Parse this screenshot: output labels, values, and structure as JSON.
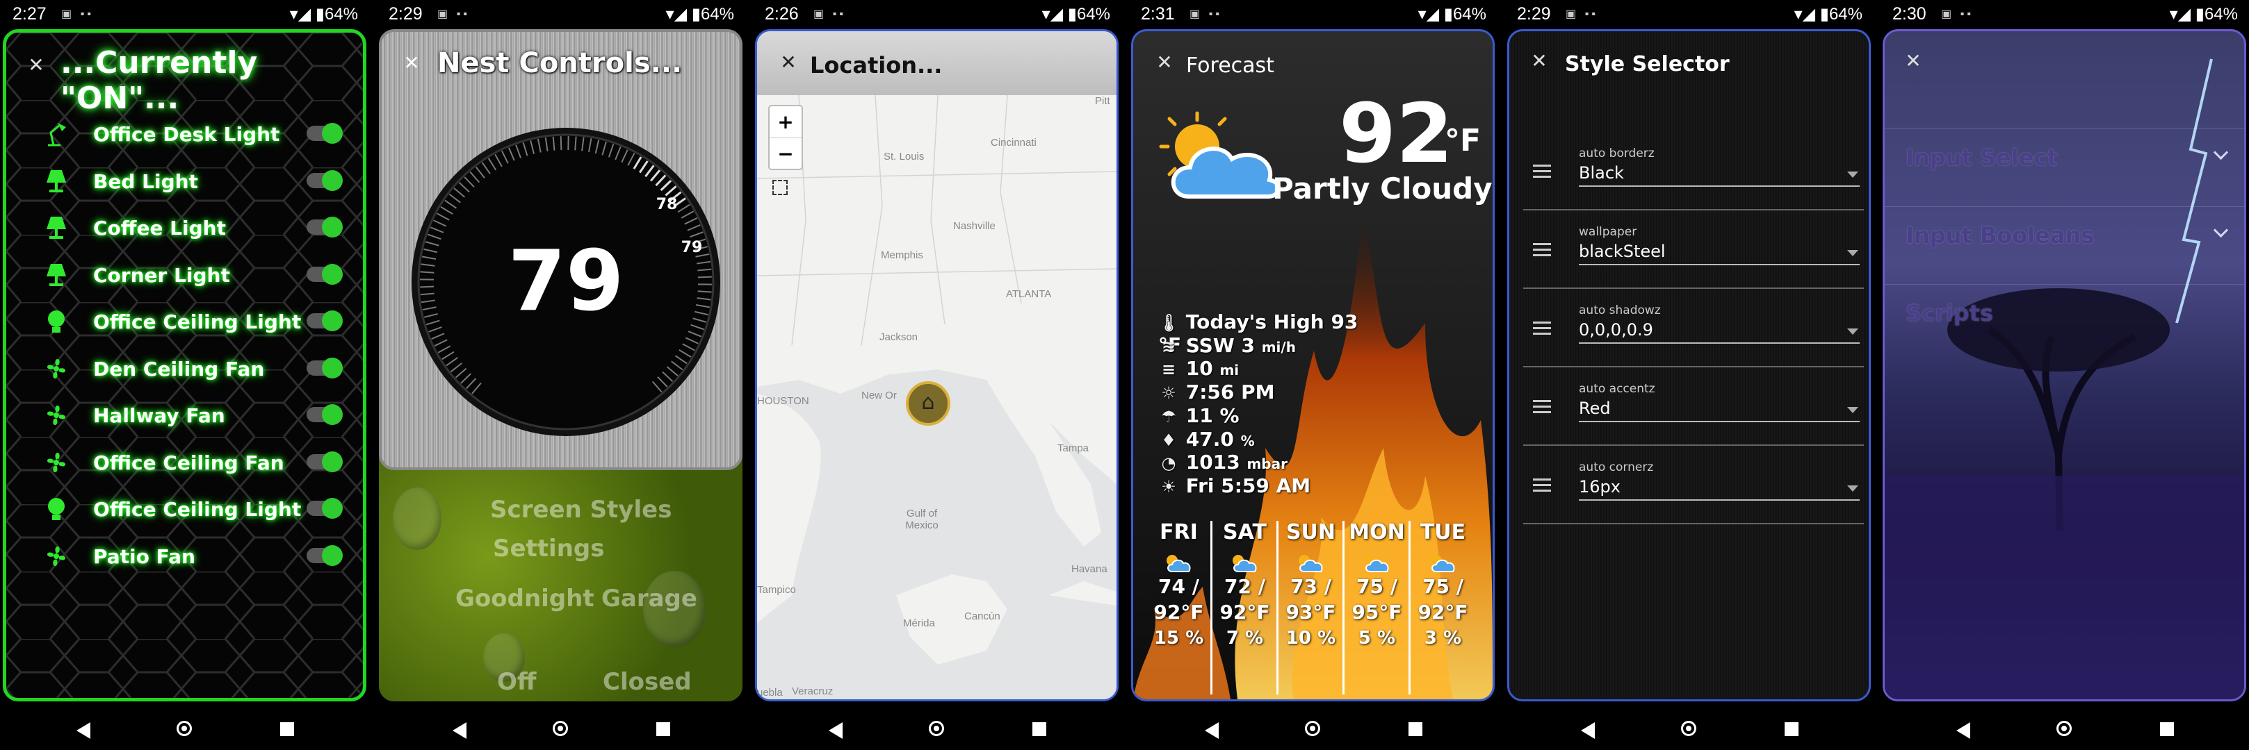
{
  "phones": [
    {
      "status": {
        "time": "2:27",
        "battery": "64%"
      },
      "title": "...Currently \"ON\"...",
      "devices": [
        {
          "label": "Office Desk Light",
          "icon": "desk-lamp-icon",
          "on": true
        },
        {
          "label": "Bed Light",
          "icon": "lamp-icon",
          "on": true
        },
        {
          "label": "Coffee Light",
          "icon": "lamp-icon",
          "on": true
        },
        {
          "label": "Corner Light",
          "icon": "lamp-icon",
          "on": true
        },
        {
          "label": "Office Ceiling Light",
          "icon": "bulb-icon",
          "on": true
        },
        {
          "label": "Den Ceiling Fan",
          "icon": "fan-icon",
          "on": true
        },
        {
          "label": "Hallway Fan",
          "icon": "fan-icon",
          "on": true
        },
        {
          "label": "Office Ceiling Fan",
          "icon": "fan-icon",
          "on": true
        },
        {
          "label": "Office Ceiling Light",
          "icon": "bulb-icon",
          "on": true
        },
        {
          "label": "Patio Fan",
          "icon": "fan-icon",
          "on": true
        }
      ]
    },
    {
      "status": {
        "time": "2:29",
        "battery": "64%"
      },
      "title": "Nest Controls...",
      "thermostat": {
        "current": "79",
        "setpoint_high": "78",
        "setpoint_low": "79"
      },
      "background_labels": [
        "Screen Styles",
        "Settings",
        "Goodnight",
        "Garage",
        "Off",
        "Closed"
      ]
    },
    {
      "status": {
        "time": "2:26",
        "battery": "64%"
      },
      "title": "Location...",
      "zoom_in": "+",
      "zoom_out": "−",
      "cities": [
        "St. Louis",
        "Cincinnati",
        "Pitt",
        "Nashville",
        "Memphis",
        "ATLANTA",
        "Jackson",
        "HOUSTON",
        "New Or",
        "Tampa",
        "Gulf of Mexico",
        "Havana",
        "Tampico",
        "Mérida",
        "Cancún",
        "uebla",
        "Veracruz"
      ]
    },
    {
      "status": {
        "time": "2:31",
        "battery": "64%"
      },
      "title": "Forecast",
      "temp": "92",
      "temp_unit": "°F",
      "condition": "Partly Cloudy",
      "stats": [
        {
          "icon": "thermometer-icon",
          "text": "Today's High 93 °F",
          "unit": ""
        },
        {
          "icon": "wind-icon",
          "text": "SSW 3 ",
          "unit": "mi/h"
        },
        {
          "icon": "visibility-icon",
          "text": "10 ",
          "unit": "mi"
        },
        {
          "icon": "sunset-icon",
          "text": "7:56 PM",
          "unit": ""
        },
        {
          "icon": "rain-icon",
          "text": "11 %",
          "unit": ""
        },
        {
          "icon": "humidity-icon",
          "text": "47.0 ",
          "unit": "%"
        },
        {
          "icon": "pressure-icon",
          "text": "1013 ",
          "unit": "mbar"
        },
        {
          "icon": "sunrise-icon",
          "text": "Fri 5:59 AM",
          "unit": ""
        }
      ],
      "days": [
        {
          "name": "FRI",
          "lo": "74 /",
          "hi": "92°F",
          "precip": "15 %"
        },
        {
          "name": "SAT",
          "lo": "72 /",
          "hi": "92°F",
          "precip": "7 %"
        },
        {
          "name": "SUN",
          "lo": "73 /",
          "hi": "93°F",
          "precip": "10 %"
        },
        {
          "name": "MON",
          "lo": "75 /",
          "hi": "95°F",
          "precip": "5 %"
        },
        {
          "name": "TUE",
          "lo": "75 /",
          "hi": "92°F",
          "precip": "3 %"
        }
      ]
    },
    {
      "status": {
        "time": "2:29",
        "battery": "64%"
      },
      "title": "Style Selector",
      "settings": [
        {
          "label": "auto borderz",
          "value": "Black"
        },
        {
          "label": "wallpaper",
          "value": "blackSteel"
        },
        {
          "label": "auto shadowz",
          "value": "0,0,0,0.9"
        },
        {
          "label": "auto accentz",
          "value": "Red"
        },
        {
          "label": "auto cornerz",
          "value": "16px"
        }
      ]
    },
    {
      "status": {
        "time": "2:30",
        "battery": "64%"
      },
      "menu": [
        "Input Select",
        "Input Booleans",
        "Scripts"
      ]
    }
  ],
  "colors": {
    "neon_green": "#22d622",
    "border_blue": "#3a5bd0",
    "border_purple": "#6a5ad0"
  }
}
